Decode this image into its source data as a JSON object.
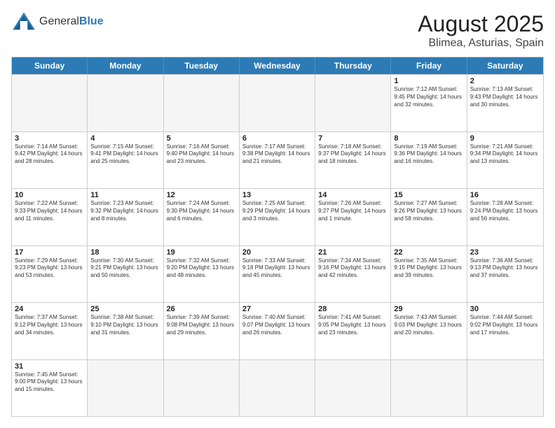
{
  "header": {
    "logo_general": "General",
    "logo_blue": "Blue",
    "title": "August 2025",
    "subtitle": "Blimea, Asturias, Spain"
  },
  "calendar": {
    "days_of_week": [
      "Sunday",
      "Monday",
      "Tuesday",
      "Wednesday",
      "Thursday",
      "Friday",
      "Saturday"
    ],
    "weeks": [
      [
        {
          "day": "",
          "info": "",
          "empty": true
        },
        {
          "day": "",
          "info": "",
          "empty": true
        },
        {
          "day": "",
          "info": "",
          "empty": true
        },
        {
          "day": "",
          "info": "",
          "empty": true
        },
        {
          "day": "",
          "info": "",
          "empty": true
        },
        {
          "day": "1",
          "info": "Sunrise: 7:12 AM\nSunset: 9:45 PM\nDaylight: 14 hours and 32 minutes."
        },
        {
          "day": "2",
          "info": "Sunrise: 7:13 AM\nSunset: 9:43 PM\nDaylight: 14 hours and 30 minutes."
        }
      ],
      [
        {
          "day": "3",
          "info": "Sunrise: 7:14 AM\nSunset: 9:42 PM\nDaylight: 14 hours and 28 minutes."
        },
        {
          "day": "4",
          "info": "Sunrise: 7:15 AM\nSunset: 9:41 PM\nDaylight: 14 hours and 25 minutes."
        },
        {
          "day": "5",
          "info": "Sunrise: 7:16 AM\nSunset: 9:40 PM\nDaylight: 14 hours and 23 minutes."
        },
        {
          "day": "6",
          "info": "Sunrise: 7:17 AM\nSunset: 9:38 PM\nDaylight: 14 hours and 21 minutes."
        },
        {
          "day": "7",
          "info": "Sunrise: 7:18 AM\nSunset: 9:37 PM\nDaylight: 14 hours and 18 minutes."
        },
        {
          "day": "8",
          "info": "Sunrise: 7:19 AM\nSunset: 9:36 PM\nDaylight: 14 hours and 16 minutes."
        },
        {
          "day": "9",
          "info": "Sunrise: 7:21 AM\nSunset: 9:34 PM\nDaylight: 14 hours and 13 minutes."
        }
      ],
      [
        {
          "day": "10",
          "info": "Sunrise: 7:22 AM\nSunset: 9:33 PM\nDaylight: 14 hours and 11 minutes."
        },
        {
          "day": "11",
          "info": "Sunrise: 7:23 AM\nSunset: 9:32 PM\nDaylight: 14 hours and 8 minutes."
        },
        {
          "day": "12",
          "info": "Sunrise: 7:24 AM\nSunset: 9:30 PM\nDaylight: 14 hours and 6 minutes."
        },
        {
          "day": "13",
          "info": "Sunrise: 7:25 AM\nSunset: 9:29 PM\nDaylight: 14 hours and 3 minutes."
        },
        {
          "day": "14",
          "info": "Sunrise: 7:26 AM\nSunset: 9:27 PM\nDaylight: 14 hours and 1 minute."
        },
        {
          "day": "15",
          "info": "Sunrise: 7:27 AM\nSunset: 9:26 PM\nDaylight: 13 hours and 58 minutes."
        },
        {
          "day": "16",
          "info": "Sunrise: 7:28 AM\nSunset: 9:24 PM\nDaylight: 13 hours and 56 minutes."
        }
      ],
      [
        {
          "day": "17",
          "info": "Sunrise: 7:29 AM\nSunset: 9:23 PM\nDaylight: 13 hours and 53 minutes."
        },
        {
          "day": "18",
          "info": "Sunrise: 7:30 AM\nSunset: 9:21 PM\nDaylight: 13 hours and 50 minutes."
        },
        {
          "day": "19",
          "info": "Sunrise: 7:32 AM\nSunset: 9:20 PM\nDaylight: 13 hours and 48 minutes."
        },
        {
          "day": "20",
          "info": "Sunrise: 7:33 AM\nSunset: 9:18 PM\nDaylight: 13 hours and 45 minutes."
        },
        {
          "day": "21",
          "info": "Sunrise: 7:34 AM\nSunset: 9:16 PM\nDaylight: 13 hours and 42 minutes."
        },
        {
          "day": "22",
          "info": "Sunrise: 7:35 AM\nSunset: 9:15 PM\nDaylight: 13 hours and 39 minutes."
        },
        {
          "day": "23",
          "info": "Sunrise: 7:36 AM\nSunset: 9:13 PM\nDaylight: 13 hours and 37 minutes."
        }
      ],
      [
        {
          "day": "24",
          "info": "Sunrise: 7:37 AM\nSunset: 9:12 PM\nDaylight: 13 hours and 34 minutes."
        },
        {
          "day": "25",
          "info": "Sunrise: 7:38 AM\nSunset: 9:10 PM\nDaylight: 13 hours and 31 minutes."
        },
        {
          "day": "26",
          "info": "Sunrise: 7:39 AM\nSunset: 9:08 PM\nDaylight: 13 hours and 29 minutes."
        },
        {
          "day": "27",
          "info": "Sunrise: 7:40 AM\nSunset: 9:07 PM\nDaylight: 13 hours and 26 minutes."
        },
        {
          "day": "28",
          "info": "Sunrise: 7:41 AM\nSunset: 9:05 PM\nDaylight: 13 hours and 23 minutes."
        },
        {
          "day": "29",
          "info": "Sunrise: 7:43 AM\nSunset: 9:03 PM\nDaylight: 13 hours and 20 minutes."
        },
        {
          "day": "30",
          "info": "Sunrise: 7:44 AM\nSunset: 9:02 PM\nDaylight: 13 hours and 17 minutes."
        }
      ],
      [
        {
          "day": "31",
          "info": "Sunrise: 7:45 AM\nSunset: 9:00 PM\nDaylight: 13 hours and 15 minutes."
        },
        {
          "day": "",
          "info": "",
          "empty": true
        },
        {
          "day": "",
          "info": "",
          "empty": true
        },
        {
          "day": "",
          "info": "",
          "empty": true
        },
        {
          "day": "",
          "info": "",
          "empty": true
        },
        {
          "day": "",
          "info": "",
          "empty": true
        },
        {
          "day": "",
          "info": "",
          "empty": true
        }
      ]
    ]
  }
}
